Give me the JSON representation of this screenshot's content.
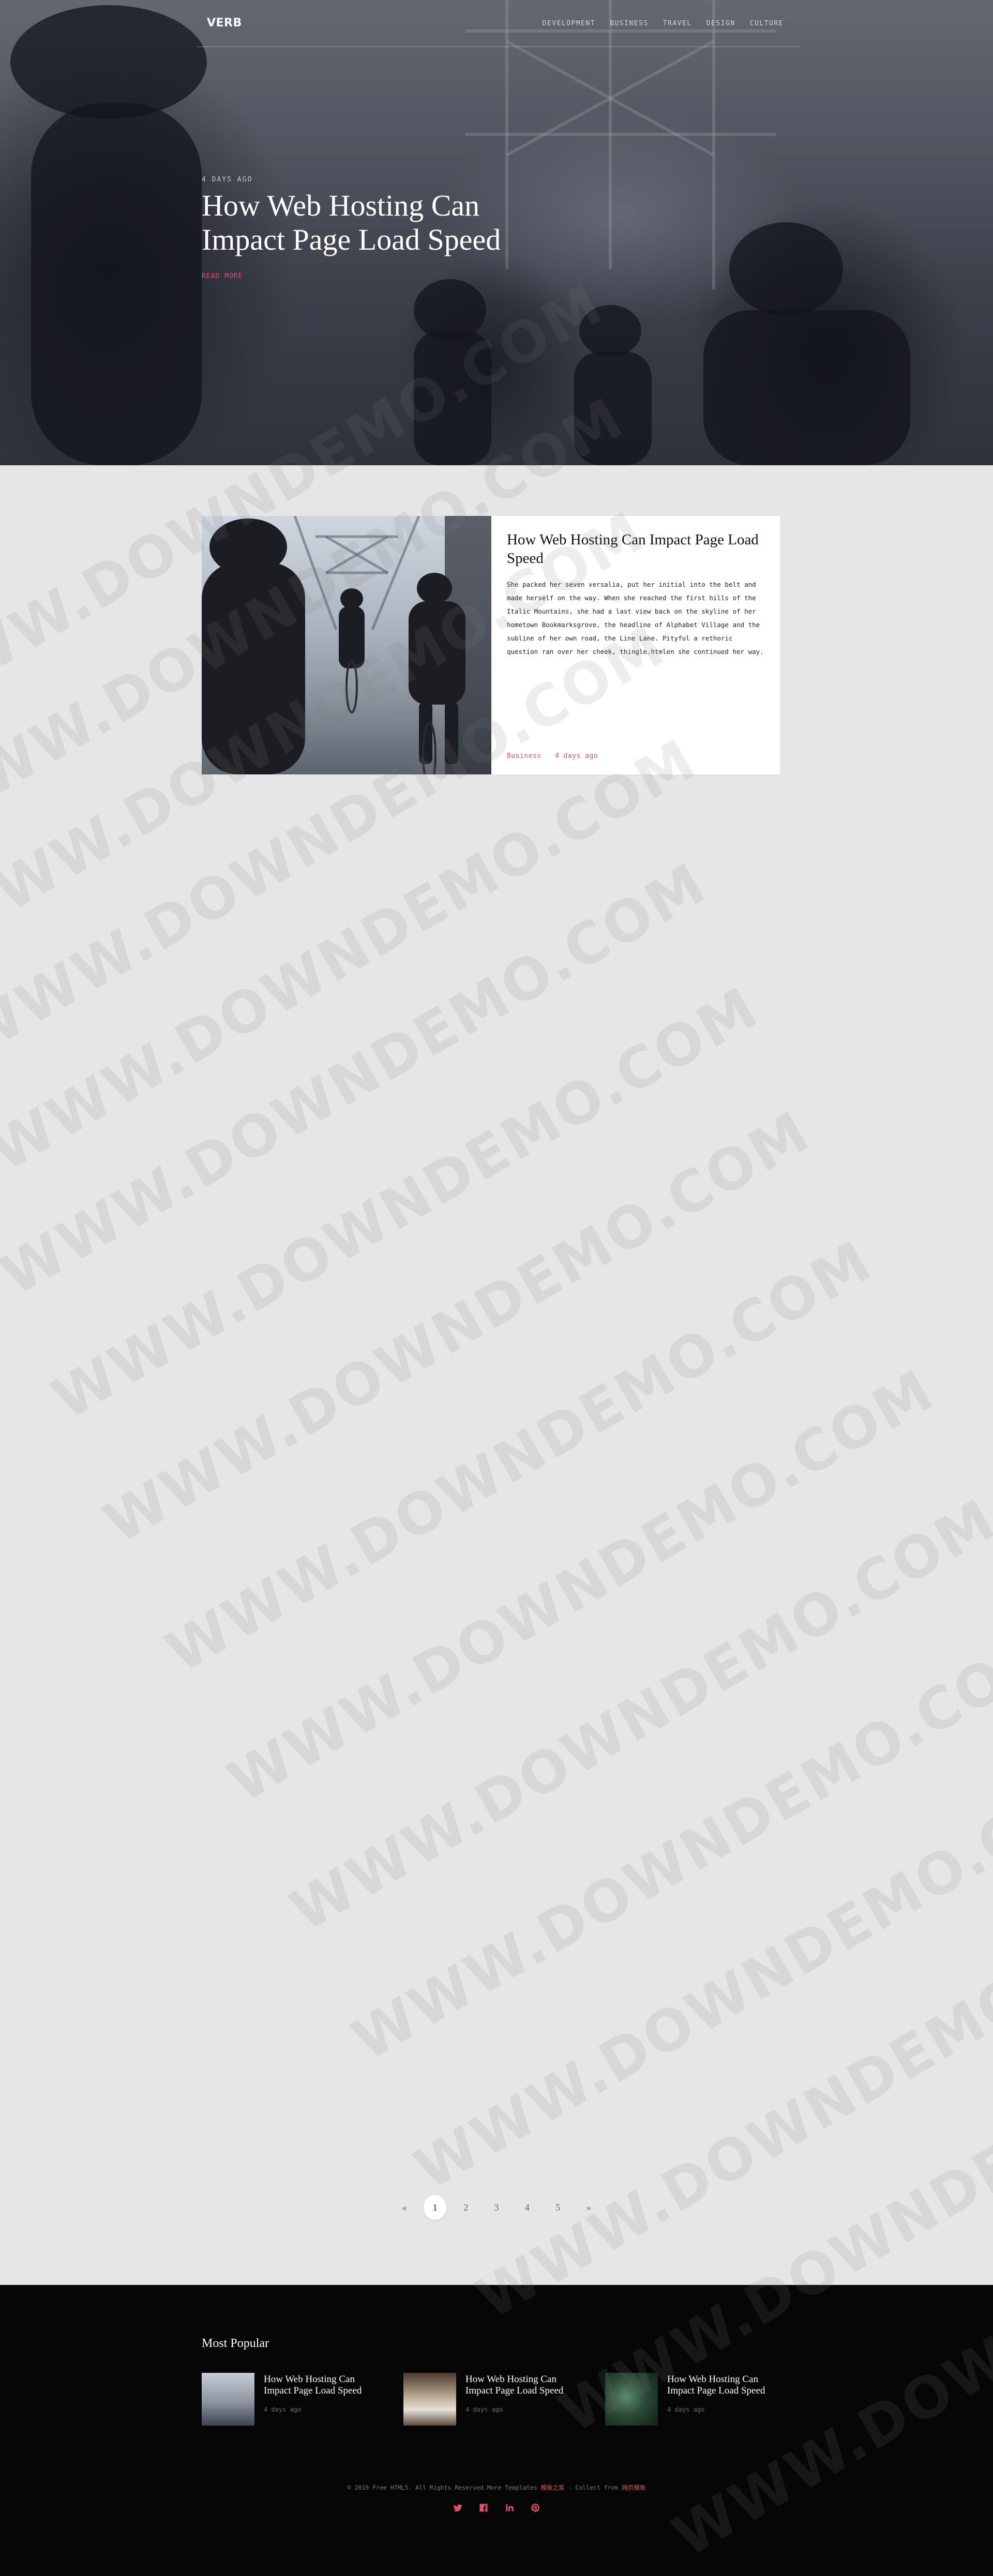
{
  "nav": {
    "logo": "VERB",
    "links": [
      "DEVELOPMENT",
      "BUSINESS",
      "TRAVEL",
      "DESIGN",
      "CULTURE"
    ]
  },
  "hero": {
    "date": "4 DAYS AGO",
    "title": "How Web Hosting Can Impact Page Load Speed",
    "read_more": "READ MORE"
  },
  "post": {
    "title": "How Web Hosting Can Impact Page Load Speed",
    "excerpt": "She packed her seven versalia, put her initial into the belt and made herself on the way. When she reached the first hills of the Italic Mountains, she had a last view back on the skyline of her hometown Bookmarksgrove, the headline of Alphabet Village and the subline of her own road, the Line Lane. Pityful a rethoric question ran over her cheek, thingle.htmlen she continued her way.",
    "category": "Business",
    "date": "4 days ago"
  },
  "watermark": "WWW.DOWNDEMO.COM",
  "pagination": [
    "«",
    "1",
    "2",
    "3",
    "4",
    "5",
    "»"
  ],
  "pagination_active": "1",
  "footer": {
    "heading": "Most Popular",
    "popular": [
      {
        "title": "How Web Hosting Can Impact Page Load Speed",
        "date": "4 days ago"
      },
      {
        "title": "How Web Hosting Can Impact Page Load Speed",
        "date": "4 days ago"
      },
      {
        "title": "How Web Hosting Can Impact Page Load Speed",
        "date": "4 days ago"
      }
    ],
    "copyright_prefix": "© 2019 Free HTML5. All Rights Reserved.More Templates ",
    "copyright_link1": "模板之家",
    "copyright_mid": " - Collect from ",
    "copyright_link2": "网页模板",
    "socials": [
      "twitter-icon",
      "facebook-icon",
      "linkedin-icon",
      "pinterest-icon"
    ]
  },
  "colors": {
    "accent": "#e84c6b",
    "page_bg": "#e6e6e6",
    "footer_bg": "#060606"
  }
}
